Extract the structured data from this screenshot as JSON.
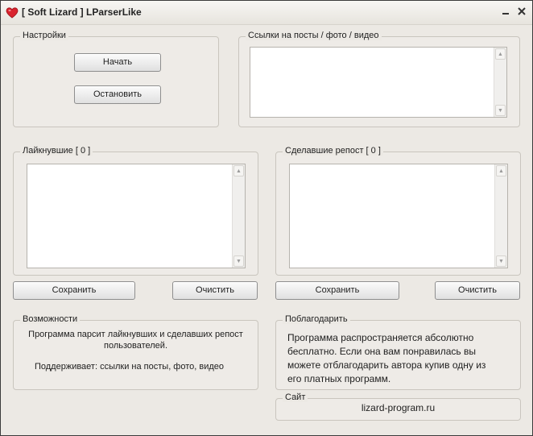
{
  "window": {
    "title": "[ Soft Lizard ] LParserLike",
    "icon": "heart-icon",
    "accent": "#d9232e",
    "controls": [
      "minimize-icon",
      "close-icon"
    ]
  },
  "settings": {
    "legend": "Настройки",
    "start_label": "Начать",
    "stop_label": "Остановить"
  },
  "links": {
    "legend": "Ссылки на посты / фото / видео",
    "value": ""
  },
  "likers": {
    "legend": "Лайкнувшие [ 0 ]",
    "value": "",
    "save_label": "Сохранить",
    "clear_label": "Очистить"
  },
  "reposters": {
    "legend": "Сделавшие репост  [ 0 ]",
    "value": "",
    "save_label": "Сохранить",
    "clear_label": "Очистить"
  },
  "features": {
    "legend": "Возможности",
    "line1": "Программа парсит лайкнувших и сделавших репост",
    "line2": "пользователей.",
    "line3": "Поддерживает: ссылки на посты, фото, видео"
  },
  "thanks": {
    "legend": "Поблагодарить",
    "lines": [
      "Программа распространяется абсолютно",
      "бесплатно. Если она вам понравилась вы",
      "можете отблагодарить автора купив одну из",
      "его платных программ."
    ]
  },
  "site": {
    "legend": "Сайт",
    "url": "lizard-program.ru"
  }
}
